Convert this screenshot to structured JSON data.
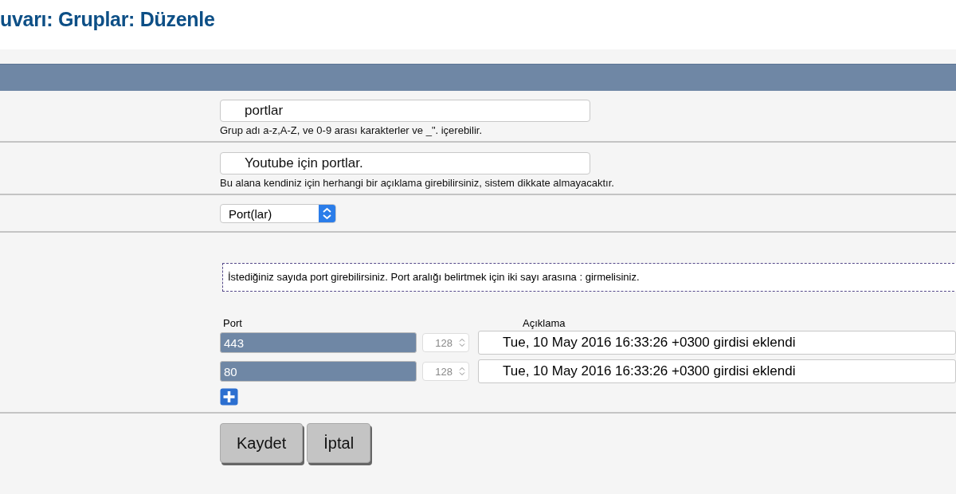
{
  "title": "uvarı: Gruplar: Düzenle",
  "name_field": {
    "value": "portlar",
    "hint": "Grup adı a-z,A-Z, ve 0-9 arası karakterler ve _\". içerebilir."
  },
  "description_field": {
    "value": "Youtube için portlar.",
    "hint": "Bu alana kendiniz için herhangi bir açıklama girebilirsiniz, sistem dikkate almayacaktır."
  },
  "type_select": {
    "value": "Port(lar)"
  },
  "info": "İstediğiniz sayıda port girebilirsiniz. Port aralığı belirtmek için iki sayı arasına : girmelisiniz.",
  "columns": [
    "Port",
    "Açıklama"
  ],
  "rows": [
    {
      "port": "443",
      "selected": true,
      "bits": "128",
      "description": "Tue, 10 May 2016 16:33:26 +0300 girdisi eklendi"
    },
    {
      "port": "80",
      "selected": true,
      "bits": "128",
      "description": "Tue, 10 May 2016 16:33:26 +0300 girdisi eklendi"
    }
  ],
  "buttons": [
    "Kaydet",
    "İptal"
  ]
}
